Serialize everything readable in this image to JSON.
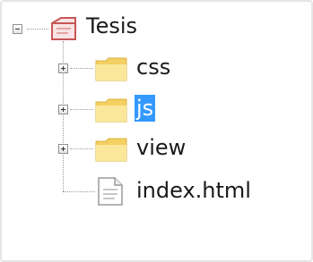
{
  "tree": {
    "root": {
      "label": "Tesis",
      "icon": "project-folder-icon",
      "expanded": true
    },
    "children": [
      {
        "label": "css",
        "icon": "folder-icon",
        "type": "folder",
        "expanded": false,
        "selected": false
      },
      {
        "label": "js",
        "icon": "folder-icon",
        "type": "folder",
        "expanded": false,
        "selected": true
      },
      {
        "label": "view",
        "icon": "folder-icon",
        "type": "folder",
        "expanded": false,
        "selected": false
      },
      {
        "label": "index.html",
        "icon": "file-icon",
        "type": "file",
        "selected": false
      }
    ]
  },
  "colors": {
    "selection": "#3399ff",
    "folder": "#f6d56a",
    "root_icon": "#d96b6b"
  }
}
